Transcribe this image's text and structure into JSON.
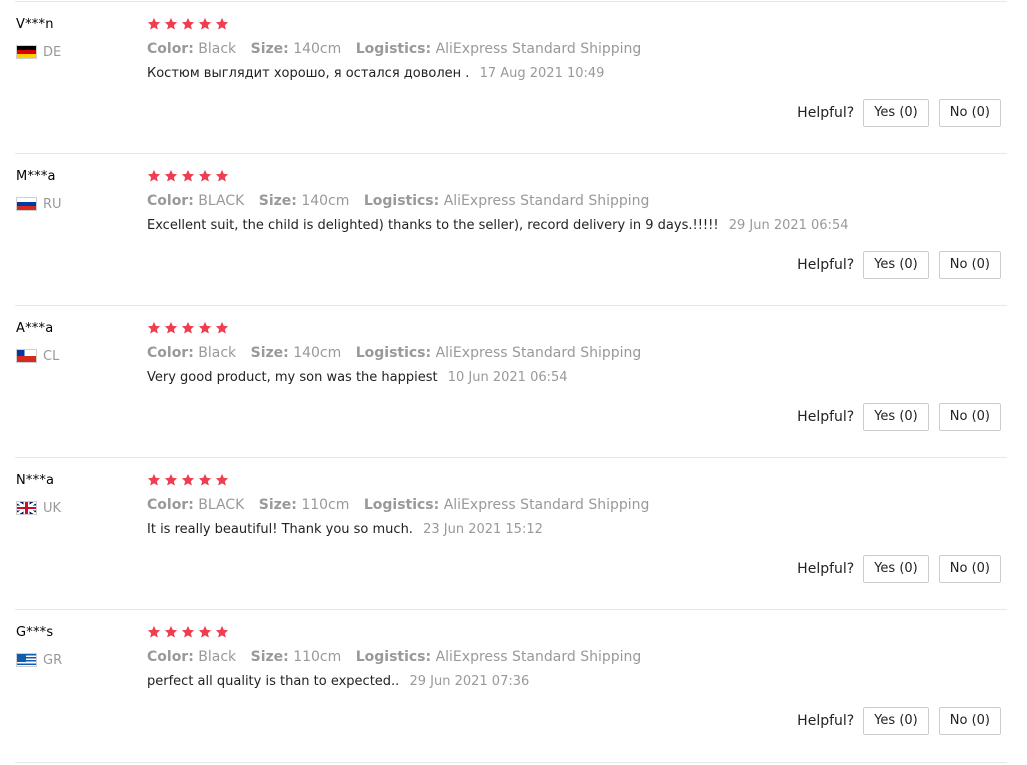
{
  "labels": {
    "color": "Color:",
    "size": "Size:",
    "logistics": "Logistics:",
    "helpful": "Helpful?"
  },
  "star_color": "#ee3f50",
  "reviews": [
    {
      "user": "V***n",
      "flag": "de",
      "country": "DE",
      "rating": 5,
      "color": "Black",
      "size": "140cm",
      "logistics": "AliExpress Standard Shipping",
      "text": "Костюм выглядит хорошо, я остался доволен .",
      "date": "17 Aug 2021 10:49",
      "yes": "Yes (0)",
      "no": "No (0)"
    },
    {
      "user": "M***a",
      "flag": "ru",
      "country": "RU",
      "rating": 5,
      "color": "BLACK",
      "size": "140cm",
      "logistics": "AliExpress Standard Shipping",
      "text": "Excellent suit, the child is delighted) thanks to the seller), record delivery in 9 days.!!!!!",
      "date": "29 Jun 2021 06:54",
      "yes": "Yes (0)",
      "no": "No (0)"
    },
    {
      "user": "A***a",
      "flag": "cl",
      "country": "CL",
      "rating": 5,
      "color": "Black",
      "size": "140cm",
      "logistics": "AliExpress Standard Shipping",
      "text": "Very good product, my son was the happiest",
      "date": "10 Jun 2021 06:54",
      "yes": "Yes (0)",
      "no": "No (0)"
    },
    {
      "user": "N***a",
      "flag": "uk",
      "country": "UK",
      "rating": 5,
      "color": "BLACK",
      "size": "110cm",
      "logistics": "AliExpress Standard Shipping",
      "text": "It is really beautiful! Thank you so much.",
      "date": "23 Jun 2021 15:12",
      "yes": "Yes (0)",
      "no": "No (0)"
    },
    {
      "user": "G***s",
      "flag": "gr",
      "country": "GR",
      "rating": 5,
      "color": "Black",
      "size": "110cm",
      "logistics": "AliExpress Standard Shipping",
      "text": "perfect all quality is than to expected..",
      "date": "29 Jun 2021 07:36",
      "yes": "Yes (0)",
      "no": "No (0)"
    }
  ]
}
